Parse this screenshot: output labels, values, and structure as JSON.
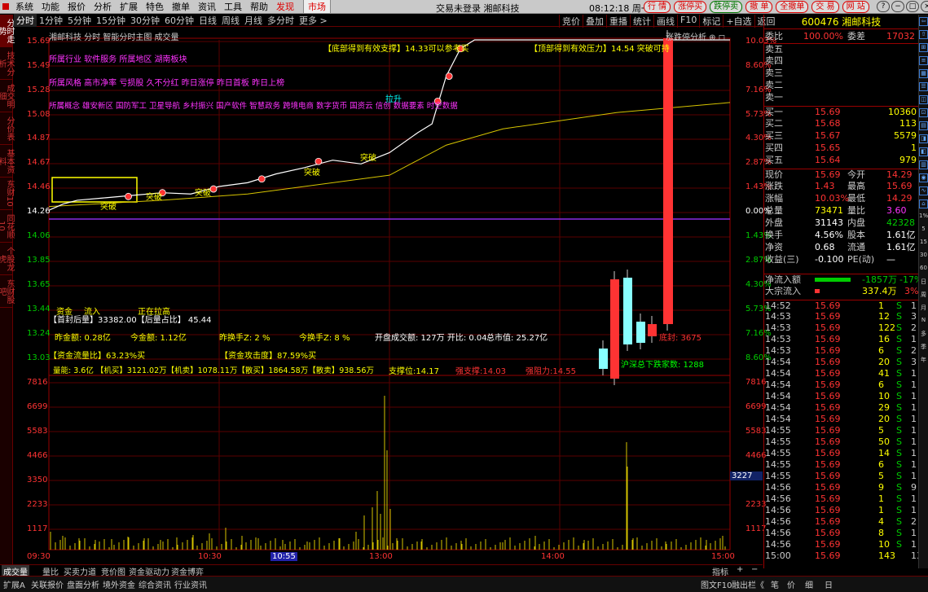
{
  "menu": [
    "系统",
    "功能",
    "报价",
    "分析",
    "扩展",
    "特色",
    "撤单",
    "资讯",
    "工具",
    "帮助"
  ],
  "menu_red": [
    "发现",
    "市场"
  ],
  "window_title": "交易未登录 湘邮科技",
  "clock": "08:12:18 周一",
  "quick_buttons": [
    "行 情",
    "涨停买",
    "跌停卖",
    "撤 单",
    "全撤单",
    "交 易",
    "网 站"
  ],
  "left_tabs": [
    "分时走势",
    "技术分析",
    "成交明细",
    "分价表",
    "基本资料",
    "东财10",
    "同花顺10",
    "个股龙虎",
    "东财股吧"
  ],
  "timeframes": [
    "分时",
    "1分钟",
    "5分钟",
    "15分钟",
    "30分钟",
    "60分钟",
    "日线",
    "周线",
    "月线",
    "多分时",
    "更多 >"
  ],
  "toolbar_right": [
    "竞价",
    "叠加",
    "重播",
    "统计",
    "画线",
    "F10",
    "标记",
    "+自选",
    "返回"
  ],
  "chart": {
    "title_left": "湘邮科技  分时 智能分时主图 成交量",
    "title_right": "涨跌停分析 ⊕ ◻",
    "price_ticks": [
      "15.69",
      "15.49",
      "15.28",
      "15.08",
      "14.87",
      "14.67",
      "14.46",
      "14.26",
      "14.06",
      "13.85",
      "13.65",
      "13.44",
      "13.24",
      "13.03"
    ],
    "pct_ticks": [
      "10.03%",
      "8.60%",
      "7.16%",
      "5.73%",
      "4.30%",
      "2.87%",
      "1.43%",
      "0.00%",
      "1.43%",
      "2.87%",
      "4.30%",
      "5.73%",
      "7.16%",
      "8.60%"
    ],
    "vol_ticks": [
      "7816",
      "6699",
      "5583",
      "4466",
      "3350",
      "2233",
      "1117"
    ],
    "vol_marker": "3227",
    "time_labels": [
      "09:30",
      "10:30",
      "10:55",
      "13:00",
      "14:00",
      "15:00"
    ],
    "info_industry": "所属行业 软件服务   所属地区 湖南板块",
    "info_style": "所属风格 高市净率 亏损股 久不分红 昨日涨停 昨日首板 昨日上榜",
    "info_concept": "所属概念 雄安新区 国防军工 卫星导航 乡村振兴 国产软件 智慧政务 跨境电商 数字货币 国资云 信创 数据要素 时空数据",
    "annot_bottom": "【底部得到有效支撑】14.33可以参考买",
    "annot_top": "【顶部得到有效压力】14.54 突破可持",
    "annot_rise": "拉升",
    "annot_breaks": [
      "突破",
      "突破",
      "突破",
      "突破",
      "突破"
    ],
    "fund_label": "资金",
    "fund_flow": "流入",
    "fund_status": "正在拉高",
    "seal_line": "【首封后量】33382.00【后量占比】 45.44",
    "amount_line": [
      "昨金额: 0.28亿",
      "今金额: 1.12亿",
      "昨换手Z: 2 %",
      "今换手Z: 8 %",
      "开盘成交额: 127万  开比: 0.04",
      "总市值: 25.27亿"
    ],
    "fund_ratio": "【资金流量比】63.23%买",
    "fund_attack": "【资金攻击度】87.59%买",
    "volume_line": "量能: 3.6亿 【机买】3121.02万【机卖】1078.11万【散买】1864.58万【散卖】938.56万",
    "support": "支撑位:14.17",
    "strong_support": "强支撑:14.03",
    "strong_resist": "强阻力:14.55",
    "bottom_seal": "底封: 3675",
    "hs_count": "沪深总下跌家数: 1288",
    "y_range": [
      14.26,
      15.69
    ]
  },
  "quote": {
    "code_name": "600476 湘邮科技",
    "weibi": "100.00%",
    "weicha": "17032",
    "sell_labels": [
      "卖五",
      "卖四",
      "卖三",
      "卖二",
      "卖一"
    ],
    "buys": [
      [
        "买一",
        "15.69",
        "10360"
      ],
      [
        "买二",
        "15.68",
        "113"
      ],
      [
        "买三",
        "15.67",
        "5579"
      ],
      [
        "买四",
        "15.65",
        "1"
      ],
      [
        "买五",
        "15.64",
        "979"
      ]
    ],
    "stats": [
      [
        "现价",
        "15.69",
        "今开",
        "14.29"
      ],
      [
        "涨跌",
        "1.43",
        "最高",
        "15.69"
      ],
      [
        "涨幅",
        "10.03%",
        "最低",
        "14.29"
      ],
      [
        "总量",
        "73471",
        "量比",
        "3.60"
      ],
      [
        "外盘",
        "31143",
        "内盘",
        "42328"
      ],
      [
        "换手",
        "4.56%",
        "股本",
        "1.61亿"
      ],
      [
        "净资",
        "0.68",
        "流通",
        "1.61亿"
      ],
      [
        "收益(三)",
        "-0.100",
        "PE(动)",
        "—"
      ]
    ],
    "netflow": [
      "净流入额",
      "-1857万",
      "-17%"
    ],
    "bigflow": [
      "大宗流入",
      "337.4万",
      "3%"
    ],
    "ticks": [
      [
        "14:52",
        "15.69",
        "1",
        "S",
        "1"
      ],
      [
        "14:53",
        "15.69",
        "12",
        "S",
        "3"
      ],
      [
        "14:53",
        "15.69",
        "122",
        "S",
        "2"
      ],
      [
        "14:53",
        "15.69",
        "16",
        "S",
        "1"
      ],
      [
        "14:53",
        "15.69",
        "6",
        "S",
        "2"
      ],
      [
        "14:54",
        "15.69",
        "20",
        "S",
        "3"
      ],
      [
        "14:54",
        "15.69",
        "41",
        "S",
        "1"
      ],
      [
        "14:54",
        "15.69",
        "6",
        "S",
        "1"
      ],
      [
        "14:54",
        "15.69",
        "10",
        "S",
        "1"
      ],
      [
        "14:54",
        "15.69",
        "29",
        "S",
        "1"
      ],
      [
        "14:54",
        "15.69",
        "20",
        "S",
        "1"
      ],
      [
        "14:55",
        "15.69",
        "5",
        "S",
        "1"
      ],
      [
        "14:55",
        "15.69",
        "50",
        "S",
        "1"
      ],
      [
        "14:55",
        "15.69",
        "14",
        "S",
        "1"
      ],
      [
        "14:55",
        "15.69",
        "6",
        "S",
        "1"
      ],
      [
        "14:55",
        "15.69",
        "5",
        "S",
        "1"
      ],
      [
        "14:56",
        "15.69",
        "9",
        "S",
        "9"
      ],
      [
        "14:56",
        "15.69",
        "1",
        "S",
        "1"
      ],
      [
        "14:56",
        "15.69",
        "1",
        "S",
        "1"
      ],
      [
        "14:56",
        "15.69",
        "4",
        "S",
        "2"
      ],
      [
        "14:56",
        "15.69",
        "8",
        "S",
        "1"
      ],
      [
        "14:56",
        "15.69",
        "10",
        "S",
        "1"
      ],
      [
        "15:00",
        "15.69",
        "143",
        "",
        "13"
      ]
    ]
  },
  "bottom_tabs": [
    "成交量",
    "量比",
    "买卖力道",
    "竞价图",
    "资金驱动力",
    "资金博弈"
  ],
  "bottom_right": [
    "指标",
    "+",
    "−"
  ],
  "status_tabs": [
    "扩展A",
    "关联报价",
    "盘面分析",
    "境外资金",
    "综合资讯",
    "行业资讯"
  ],
  "status_right": [
    "图文F10",
    "融出栏《"
  ],
  "panel_tabs": [
    "笔",
    "价",
    "细",
    "日"
  ],
  "side_icons": [
    "⇦",
    "⇧",
    "⊞",
    "≡",
    "▦",
    "☰",
    "◫",
    "⊡",
    "▤",
    "◨",
    "◧",
    "▥",
    "◉",
    "∿",
    "⌂"
  ],
  "side_labels": [
    "1%",
    "5",
    "15",
    "30",
    "60",
    "日",
    "周",
    "月",
    "N",
    "多",
    "季",
    "年"
  ],
  "colors": {
    "up": "#ff3333",
    "down": "#00dd00",
    "price": "#ffffff",
    "avg": "#d6c400",
    "base": "#8a2be2"
  },
  "chart_data": {
    "type": "line",
    "price_path": [
      [
        0,
        14.33
      ],
      [
        5,
        14.38
      ],
      [
        10,
        14.41
      ],
      [
        20,
        14.43
      ],
      [
        30,
        14.45
      ],
      [
        40,
        14.47
      ],
      [
        50,
        14.46
      ],
      [
        60,
        14.52
      ],
      [
        70,
        14.55
      ],
      [
        80,
        14.62
      ],
      [
        90,
        14.67
      ],
      [
        100,
        14.73
      ],
      [
        110,
        14.7
      ],
      [
        120,
        14.79
      ],
      [
        130,
        14.95
      ],
      [
        135,
        15.02
      ],
      [
        140,
        15.4
      ],
      [
        145,
        15.62
      ],
      [
        150,
        15.69
      ],
      [
        240,
        15.69
      ]
    ],
    "avg_path": [
      [
        0,
        14.36
      ],
      [
        40,
        14.41
      ],
      [
        70,
        14.46
      ],
      [
        90,
        14.52
      ],
      [
        120,
        14.61
      ],
      [
        140,
        14.85
      ],
      [
        160,
        14.98
      ],
      [
        200,
        15.11
      ],
      [
        240,
        15.19
      ]
    ]
  }
}
